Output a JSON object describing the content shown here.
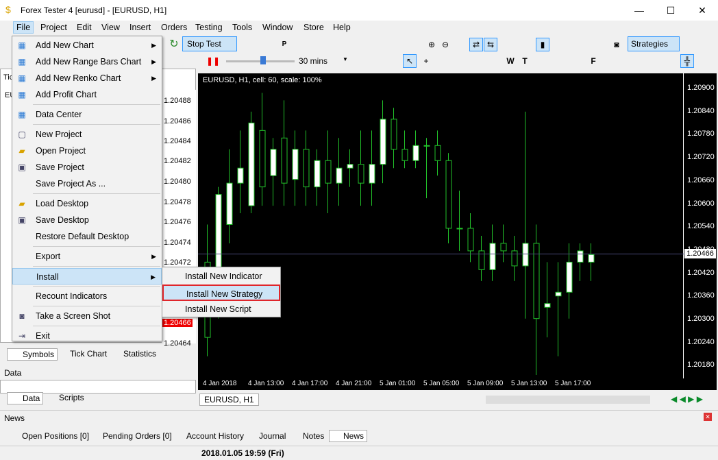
{
  "window": {
    "title": "Forex Tester 4  [eurusd] - [EURUSD, H1]",
    "min": "—",
    "max": "☐",
    "close": "✕"
  },
  "menubar": {
    "items": [
      "File",
      "Project",
      "Edit",
      "View",
      "Insert",
      "Orders",
      "Testing",
      "Tools",
      "Window",
      "Store",
      "Help"
    ]
  },
  "toolbar": {
    "stop_test": "Stop Test",
    "strategies": "Strategies",
    "timeframe": "30 mins"
  },
  "file_menu": {
    "items": [
      {
        "label": "Add New Chart",
        "icon": "chart-icon",
        "submenu": true
      },
      {
        "label": "Add New Range Bars Chart",
        "icon": "chart-icon",
        "submenu": true
      },
      {
        "label": "Add New Renko Chart",
        "icon": "chart-icon",
        "submenu": true
      },
      {
        "label": "Add Profit Chart",
        "icon": "chart-icon",
        "submenu": false
      },
      {
        "label": "Data Center",
        "icon": "chart-icon",
        "submenu": false
      },
      {
        "label": "New Project",
        "icon": "new-file-icon",
        "submenu": false
      },
      {
        "label": "Open Project",
        "icon": "folder-icon",
        "submenu": false
      },
      {
        "label": "Save Project",
        "icon": "save-icon",
        "submenu": false
      },
      {
        "label": "Save Project As ...",
        "icon": "",
        "submenu": false
      },
      {
        "label": "Load Desktop",
        "icon": "folder-icon",
        "submenu": false
      },
      {
        "label": "Save Desktop",
        "icon": "save-icon",
        "submenu": false
      },
      {
        "label": "Restore Default Desktop",
        "icon": "",
        "submenu": false
      },
      {
        "label": "Export",
        "icon": "",
        "submenu": true
      },
      {
        "label": "Install",
        "icon": "",
        "submenu": true
      },
      {
        "label": "Recount Indicators",
        "icon": "",
        "submenu": false
      },
      {
        "label": "Take a Screen Shot",
        "icon": "camera-icon",
        "submenu": false
      },
      {
        "label": "Exit",
        "icon": "exit-icon",
        "submenu": false
      }
    ]
  },
  "install_submenu": {
    "items": [
      "Install New Indicator",
      "Install New Strategy",
      "Install New Script"
    ]
  },
  "left_panel": {
    "prices": [
      "1.20488",
      "1.20486",
      "1.20484",
      "1.20482",
      "1.20480",
      "1.20478",
      "1.20476",
      "1.20474",
      "1.20472",
      "1.20466",
      "1.20464"
    ],
    "tabs": [
      "Symbols",
      "Tick Chart",
      "Statistics"
    ],
    "data_title": "Data",
    "data_tabs": [
      "Data",
      "Scripts"
    ],
    "tick_label": "Tic",
    "sym": "EU"
  },
  "chart": {
    "label": "EURUSD, H1, cell: 60, scale: 100%",
    "tab": "EURUSD, H1",
    "current_price": "1.20466",
    "price_labels": [
      "1.20900",
      "1.20840",
      "1.20780",
      "1.20720",
      "1.20660",
      "1.20600",
      "1.20540",
      "1.20480",
      "1.20420",
      "1.20360",
      "1.20300",
      "1.20240",
      "1.20180"
    ],
    "time_labels": [
      "4 Jan 2018",
      "4 Jan 13:00",
      "4 Jan 17:00",
      "4 Jan 21:00",
      "5 Jan 01:00",
      "5 Jan 05:00",
      "5 Jan 09:00",
      "5 Jan 13:00",
      "5 Jan 17:00"
    ]
  },
  "news": {
    "title": "News"
  },
  "bottom_tabs": [
    "Open Positions [0]",
    "Pending Orders [0]",
    "Account History",
    "Journal",
    "Notes",
    "News"
  ],
  "status": {
    "datetime": "2018.01.05 19:59 (Fri)"
  },
  "chart_data": {
    "type": "candlestick",
    "ylim": [
      1.2015,
      1.2093
    ],
    "candles": [
      [
        1.2045,
        1.2055,
        1.202,
        1.2025
      ],
      [
        1.2035,
        1.2065,
        1.203,
        1.2063
      ],
      [
        1.2055,
        1.2075,
        1.205,
        1.2066
      ],
      [
        1.2066,
        1.208,
        1.2058,
        1.207
      ],
      [
        1.206,
        1.2085,
        1.2058,
        1.2082
      ],
      [
        1.208,
        1.209,
        1.206,
        1.2065
      ],
      [
        1.2068,
        1.2078,
        1.206,
        1.2075
      ],
      [
        1.2078,
        1.2088,
        1.206,
        1.2066
      ],
      [
        1.2067,
        1.208,
        1.206,
        1.2075
      ],
      [
        1.2075,
        1.208,
        1.206,
        1.2065
      ],
      [
        1.2065,
        1.2075,
        1.206,
        1.2072
      ],
      [
        1.2072,
        1.208,
        1.2058,
        1.2066
      ],
      [
        1.2066,
        1.2078,
        1.206,
        1.207
      ],
      [
        1.207,
        1.2075,
        1.2065,
        1.2071
      ],
      [
        1.2071,
        1.208,
        1.206,
        1.2066
      ],
      [
        1.2066,
        1.208,
        1.206,
        1.2071
      ],
      [
        1.2071,
        1.2088,
        1.2066,
        1.2083
      ],
      [
        1.2083,
        1.2086,
        1.207,
        1.2075
      ],
      [
        1.2075,
        1.208,
        1.207,
        1.2072
      ],
      [
        1.2072,
        1.208,
        1.207,
        1.2076
      ],
      [
        1.2076,
        1.2078,
        1.2062,
        1.2076
      ],
      [
        1.2076,
        1.208,
        1.2068,
        1.2072
      ],
      [
        1.2072,
        1.2074,
        1.205,
        1.2054
      ],
      [
        1.2054,
        1.2064,
        1.2048,
        1.2054
      ],
      [
        1.2054,
        1.2058,
        1.2045,
        1.2048
      ],
      [
        1.2048,
        1.2052,
        1.204,
        1.2043
      ],
      [
        1.2043,
        1.2055,
        1.204,
        1.205
      ],
      [
        1.205,
        1.2055,
        1.2045,
        1.2048
      ],
      [
        1.2048,
        1.2052,
        1.204,
        1.2044
      ],
      [
        1.2044,
        1.2085,
        1.203,
        1.205
      ],
      [
        1.205,
        1.2055,
        1.2015,
        1.203
      ],
      [
        1.2033,
        1.2045,
        1.2025,
        1.2034
      ],
      [
        1.2036,
        1.2045,
        1.202,
        1.2037
      ],
      [
        1.2037,
        1.205,
        1.203,
        1.2045
      ],
      [
        1.2045,
        1.205,
        1.204,
        1.2048
      ],
      [
        1.2045,
        1.205,
        1.204,
        1.2047
      ]
    ]
  }
}
